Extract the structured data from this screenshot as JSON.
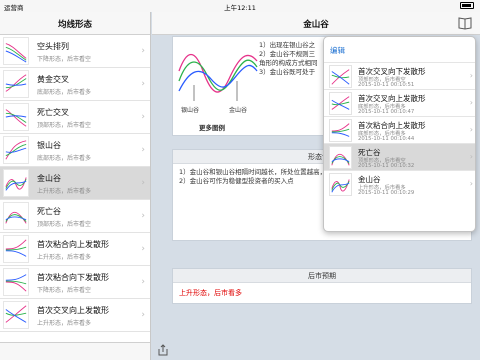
{
  "status_bar": {
    "carrier": "运营商",
    "time": "上午12:11"
  },
  "left_panel": {
    "title": "均线形态",
    "items": [
      {
        "name": "空头排列",
        "desc": "下降形态，后市看空"
      },
      {
        "name": "黄金交叉",
        "desc": "底部形态，后市看多"
      },
      {
        "name": "死亡交叉",
        "desc": "顶部形态，后市看空"
      },
      {
        "name": "银山谷",
        "desc": "底部形态，后市看多"
      },
      {
        "name": "金山谷",
        "desc": "上升形态，后市看多"
      },
      {
        "name": "死亡谷",
        "desc": "顶部形态，后市看空"
      },
      {
        "name": "首次粘合向上发散形",
        "desc": "上升形态，后市看多"
      },
      {
        "name": "首次粘合向下发散形",
        "desc": "下降形态，后市看空"
      },
      {
        "name": "首次交叉向上发散形",
        "desc": "上升形态，后市看多"
      }
    ]
  },
  "detail": {
    "title": "金山谷",
    "chart_labels": {
      "left": "银山谷",
      "right": "金山谷"
    },
    "more_link": "更多图例",
    "intro_lines": [
      "1）出现在银山谷之",
      "2）金山谷不规则三",
      "角形的构成方式相同",
      "3）金山谷既可处于"
    ],
    "section2_title": "形态含义",
    "meaning_lines": [
      "1）金山谷和银山谷相隔时间越长，所处位置越高，",
      "2）金山谷可作为稳健型投资者的买入点"
    ],
    "section3_title": "后市预期",
    "outlook": "上升形态，后市看多"
  },
  "popover": {
    "edit_label": "编辑",
    "items": [
      {
        "name": "首次交叉向下发散形",
        "desc": "顶部形态，后市看空",
        "date": "2015-10-11 00:10:51"
      },
      {
        "name": "首次交叉向上发散形",
        "desc": "底部形态，后市看多",
        "date": "2015-10-11 00:10:47"
      },
      {
        "name": "首次粘合向上发散形",
        "desc": "底部形态，后市看多",
        "date": "2015-10-11 00:10:44"
      },
      {
        "name": "死亡谷",
        "desc": "顶部形态，后市看空",
        "date": "2015-10-11 00:10:32"
      },
      {
        "name": "金山谷",
        "desc": "上升形态，后市看多",
        "date": "2015-10-11 00:10:29"
      }
    ]
  },
  "colors": {
    "accent": "#1b6fd1",
    "alert": "#e00000",
    "line_blue": "#2a5cff",
    "line_green": "#2bb24c",
    "line_pink": "#e6338a"
  }
}
